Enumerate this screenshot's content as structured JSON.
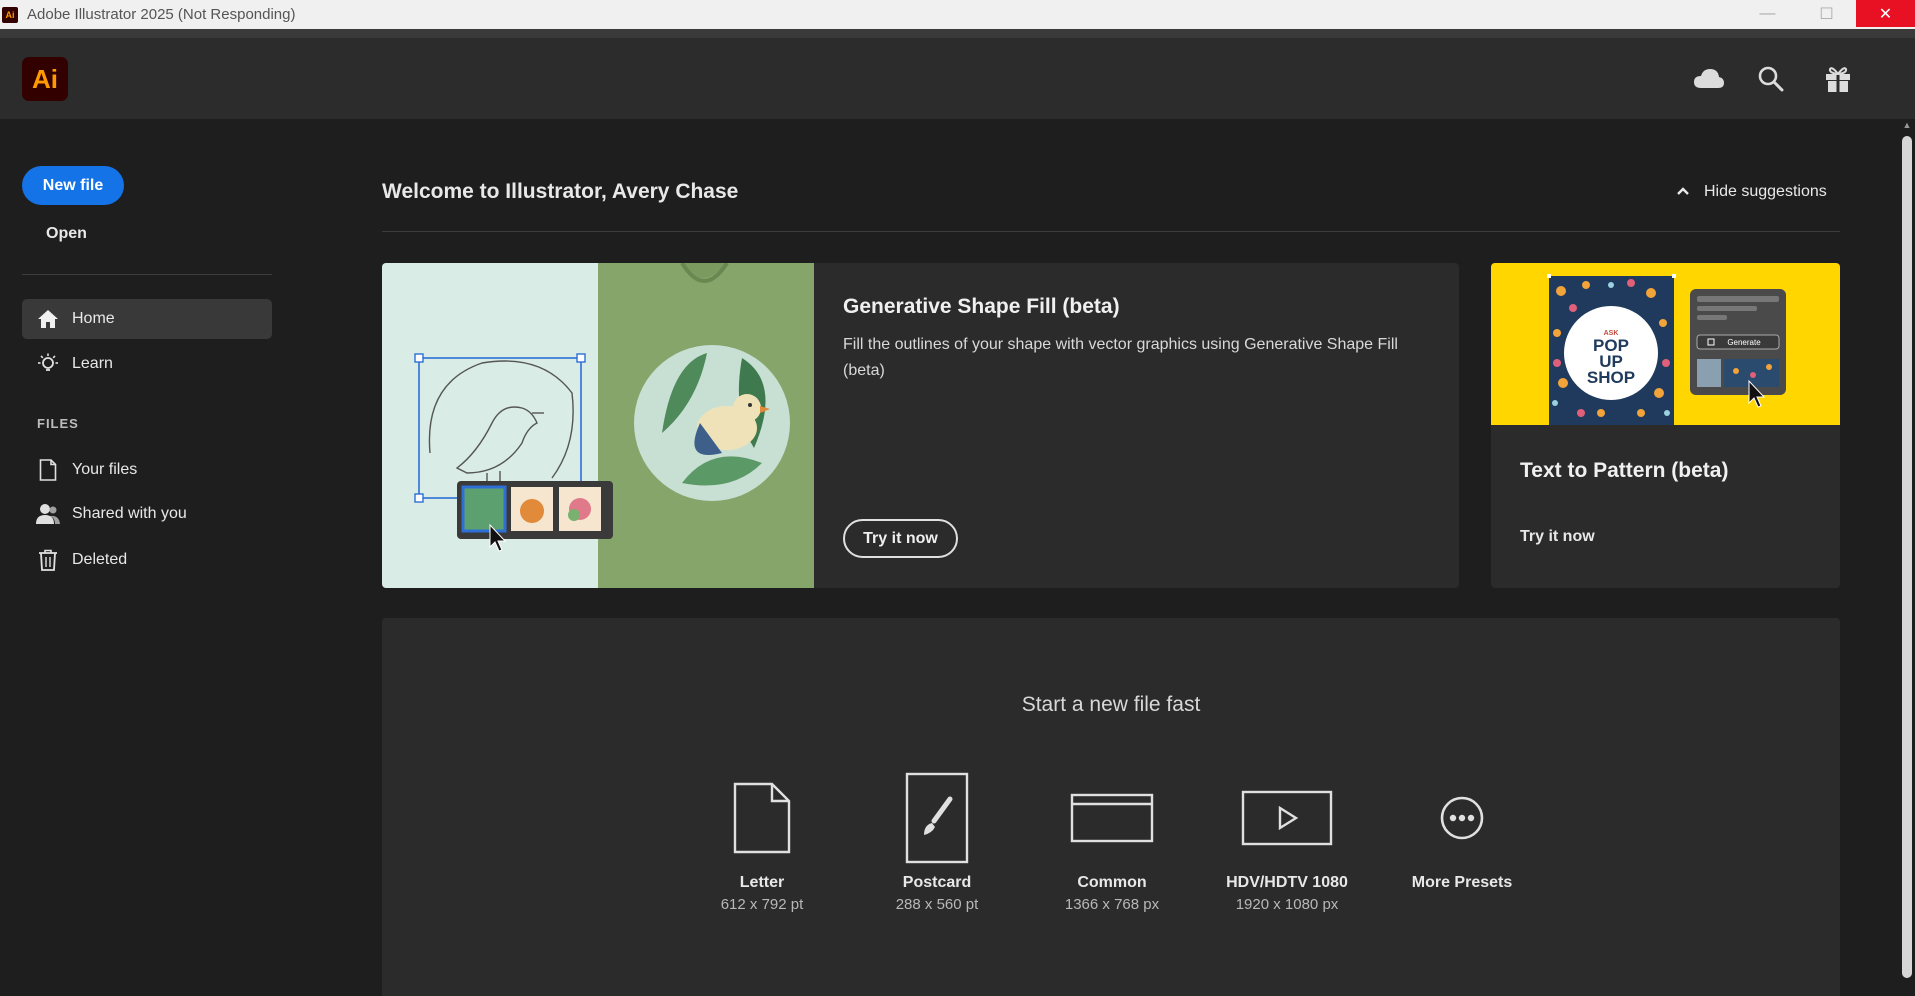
{
  "window": {
    "title": "Adobe Illustrator 2025 (Not Responding)",
    "app_icon_text": "Ai",
    "minimize": "—",
    "maximize": "☐",
    "close": "✕"
  },
  "header": {
    "logo_text": "Ai",
    "icons": [
      "cloud-icon",
      "search-icon",
      "gift-icon"
    ]
  },
  "sidebar": {
    "new_file_label": "New file",
    "open_label": "Open",
    "nav": [
      {
        "label": "Home",
        "icon": "home-icon",
        "active": true
      },
      {
        "label": "Learn",
        "icon": "lightbulb-icon",
        "active": false
      }
    ],
    "files_heading": "FILES",
    "files": [
      {
        "label": "Your files",
        "icon": "document-icon"
      },
      {
        "label": "Shared with you",
        "icon": "people-icon"
      },
      {
        "label": "Deleted",
        "icon": "trash-icon"
      }
    ]
  },
  "main": {
    "welcome": "Welcome to Illustrator, Avery Chase",
    "hide_suggestions": "Hide suggestions",
    "feature_card": {
      "title": "Generative Shape Fill (beta)",
      "description": "Fill the outlines of your shape with vector graphics using Generative Shape Fill (beta)",
      "button": "Try it now"
    },
    "pattern_card": {
      "title": "Text to Pattern (beta)",
      "link": "Try it now",
      "poster_text": [
        "POP",
        "UP",
        "SHOP"
      ],
      "generate_label": "Generate"
    },
    "new_file_fast": {
      "title": "Start a new file fast",
      "presets": [
        {
          "name": "Letter",
          "dims": "612 x 792 pt",
          "icon": "letter-page-icon"
        },
        {
          "name": "Postcard",
          "dims": "288 x 560 pt",
          "icon": "postcard-brush-icon"
        },
        {
          "name": "Common",
          "dims": "1366 x 768 px",
          "icon": "browser-window-icon"
        },
        {
          "name": "HDV/HDTV 1080",
          "dims": "1920 x 1080 px",
          "icon": "video-play-icon"
        },
        {
          "name": "More Presets",
          "dims": "",
          "icon": "more-dots-icon"
        }
      ]
    }
  },
  "colors": {
    "accent_blue": "#1473e6",
    "ai_logo_bg": "#330000",
    "ai_logo_fg": "#ff9a00",
    "close_red": "#e81123",
    "pattern_yellow": "#ffd600"
  }
}
